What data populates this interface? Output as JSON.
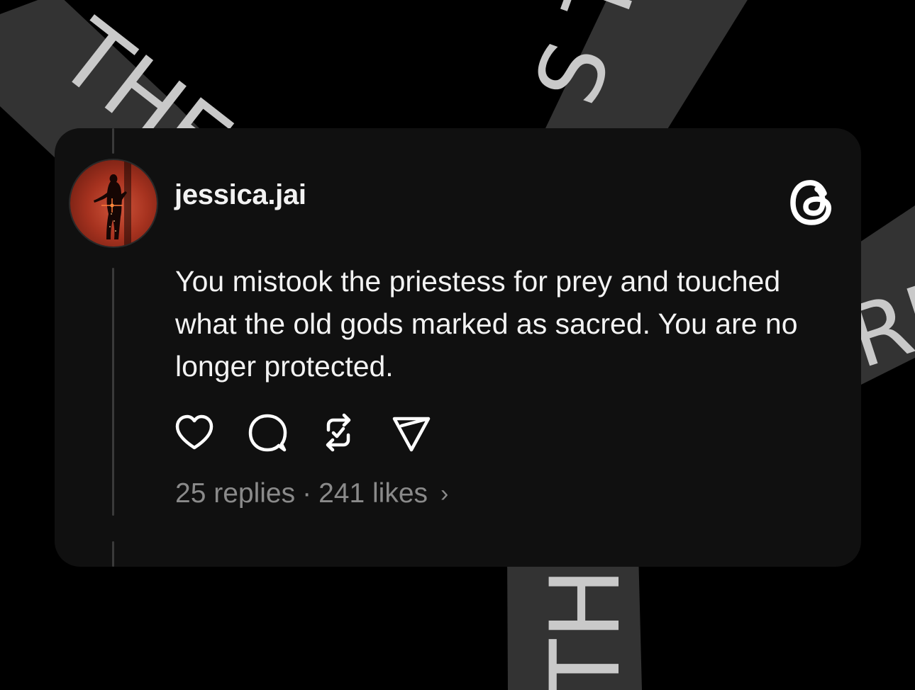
{
  "background": {
    "ribbon_1_text": "THE",
    "ribbon_2_text": "S T",
    "ribbon_3_text": "RD",
    "ribbon_4_text": "TH",
    "ribbon_color": "#333333"
  },
  "post": {
    "username": "jessica.jai",
    "text": "You mistook the priestess for prey and touched what the old gods marked as sacred. You are no longer protected.",
    "replies": "25 replies",
    "separator": "·",
    "likes": "241 likes",
    "chevron": "›"
  },
  "icons": {
    "like": "heart-icon",
    "reply": "comment-icon",
    "repost": "repost-icon",
    "share": "send-icon",
    "brand": "threads-logo-icon"
  },
  "colors": {
    "card_bg": "#101010",
    "text": "#f3f3f3",
    "muted": "#8a8a8a",
    "page_bg": "#000000"
  }
}
